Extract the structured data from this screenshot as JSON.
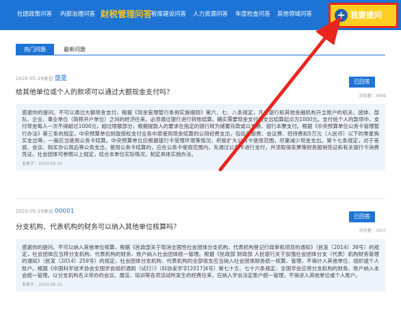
{
  "nav": {
    "items": [
      {
        "label": "社团政策问答"
      },
      {
        "label": "内部治理问答"
      },
      {
        "label": "财税管理问答"
      },
      {
        "label": "智库建设问答"
      },
      {
        "label": "人力资源问答"
      },
      {
        "label": "年度检查问答"
      },
      {
        "label": "其他领域问答"
      }
    ],
    "active_index": 2,
    "ask_label": "我要提问"
  },
  "tabs": [
    {
      "label": "热门问题"
    },
    {
      "label": "最新问题"
    }
  ],
  "questions": [
    {
      "date": "2020-05-29来自",
      "user": "盛夏",
      "title": "给其他单位或个人的款项可以通过大额现金支付吗？",
      "status": "已回答",
      "views": "浏览量：3969",
      "answer": "感谢你的提问。不可以通过大额现金支付，根据《现金管理暂行条例实施细则》第六、七、八条规定，凡在银行和其他金融机构开立账户的机关、团体、部队、企业、事业单位（简称开户单位）之间的经济往来，必须通过银行进行转账结算。确实需要现金支付的支出结算起点为1000元。支付给个人的款项中，支付现金每人一次不得超过1000元，超过限额部分，根据提款人的要求在指定的银行转为储蓄存款或以支票、银行本票支付。根据《中央预算单位公务卡管理暂行办法》第三条的规定，中央预算单位财政授权支付业务中原使用现金结算的公用经费支出，包括差旅费、会议费、招待费和5万元（人民币）以下的零星购买支出等，一般应当使用公务卡结算。中央预算单位应根据银行卡受理环境等情况，积极扩大公务卡使用范围，尽量减少现金支出。第十七条规定，对于差旅、会议、购买办公用品等公务支出，使用公务卡结算的，应在公务卡使用范围内，先通过公务卡进行支付，并须取得发票等财务报销凭证和有关银行卡消费凭证。社会团体可参照以上规定，结合本单位实际情况，制定具体实施办法。",
      "reply_date": "发表于：2020-09-10"
    },
    {
      "date": "2020-05-29来自",
      "user": "00001",
      "title": "分支机构、代表机构的财务可以纳入其他单位核算吗？",
      "status": "已回答",
      "views": "浏览量：3937",
      "answer": "感谢你的提问。不可以纳入其他单位核算，根据《民政部关于取消全国性社会团体分支机构、代表机构登记行政审批项目的通知》（民发〔2014〕38号）的规定，社会团体应当将分支机构、代表机构的财务、账户纳入社会团体统一管理。根据《民政部 财政部 人民银行关于加强社会团体分支（代表）机构财务管理的通知》（民发〔2014〕259号）的规定，社会团体分支机构、代表机构的全部收支应当纳入社会团体财务统一核算、管理，不得计入其他单位、组织或个人账户。根据《中国科学技术协会全国学会组织通则（试行）》（科协发学字[2017]4号）第七十五、七十六条规定，全国学会应将分支机构的财务、账户纳入本会统一管理。以分支机构名义举办的会议、展览、培训等各项活动所发生的经费往来，应纳入学会法定账户统一管理，不得进入其他单位或个人账户。",
      "reply_date": "发表于：2020-09-10"
    }
  ],
  "colors": {
    "nav_bg": "#1e74d4",
    "active_nav_text": "#f8c41b",
    "ask_button_bg": "#fecf1f",
    "highlight_border": "#e8261d",
    "answer_bg": "#edf4fc"
  }
}
